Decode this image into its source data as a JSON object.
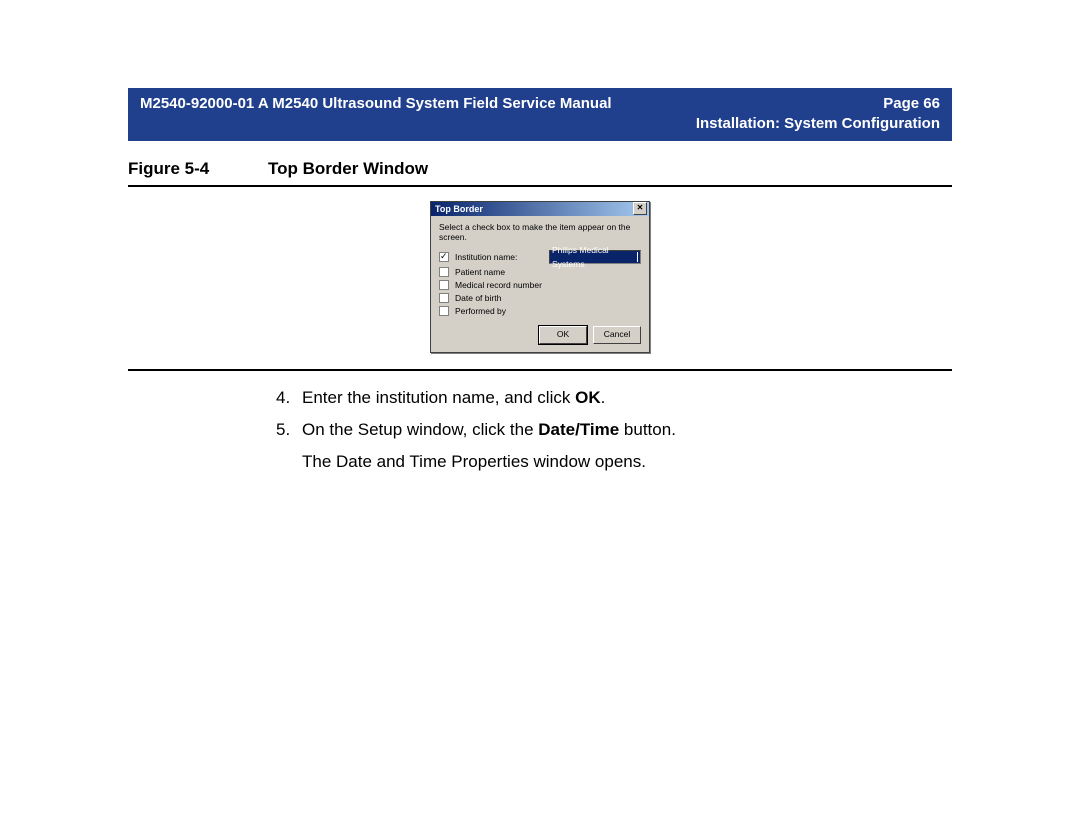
{
  "header": {
    "doc_title": "M2540-92000-01 A M2540 Ultrasound System Field Service Manual",
    "page_label": "Page 66",
    "section": "Installation: System Configuration"
  },
  "figure": {
    "label": "Figure 5-4",
    "title": "Top Border Window"
  },
  "dialog": {
    "title": "Top Border",
    "close_glyph": "✕",
    "instruction": "Select a check box to make the item appear on the screen.",
    "rows": [
      {
        "checked": true,
        "label": "Institution name:"
      },
      {
        "checked": false,
        "label": "Patient name"
      },
      {
        "checked": false,
        "label": "Medical record number"
      },
      {
        "checked": false,
        "label": "Date of birth"
      },
      {
        "checked": false,
        "label": "Performed by"
      }
    ],
    "institution_value": "Philips Medical Systems",
    "ok_label": "OK",
    "cancel_label": "Cancel"
  },
  "steps": {
    "s4_num": "4.",
    "s4_a": "Enter the institution name, and click ",
    "s4_b": "OK",
    "s4_c": ".",
    "s5_num": "5.",
    "s5_a": "On the Setup window, click the ",
    "s5_b": "Date/Time",
    "s5_c": " button.",
    "s5_sub": "The Date and Time Properties window opens."
  }
}
